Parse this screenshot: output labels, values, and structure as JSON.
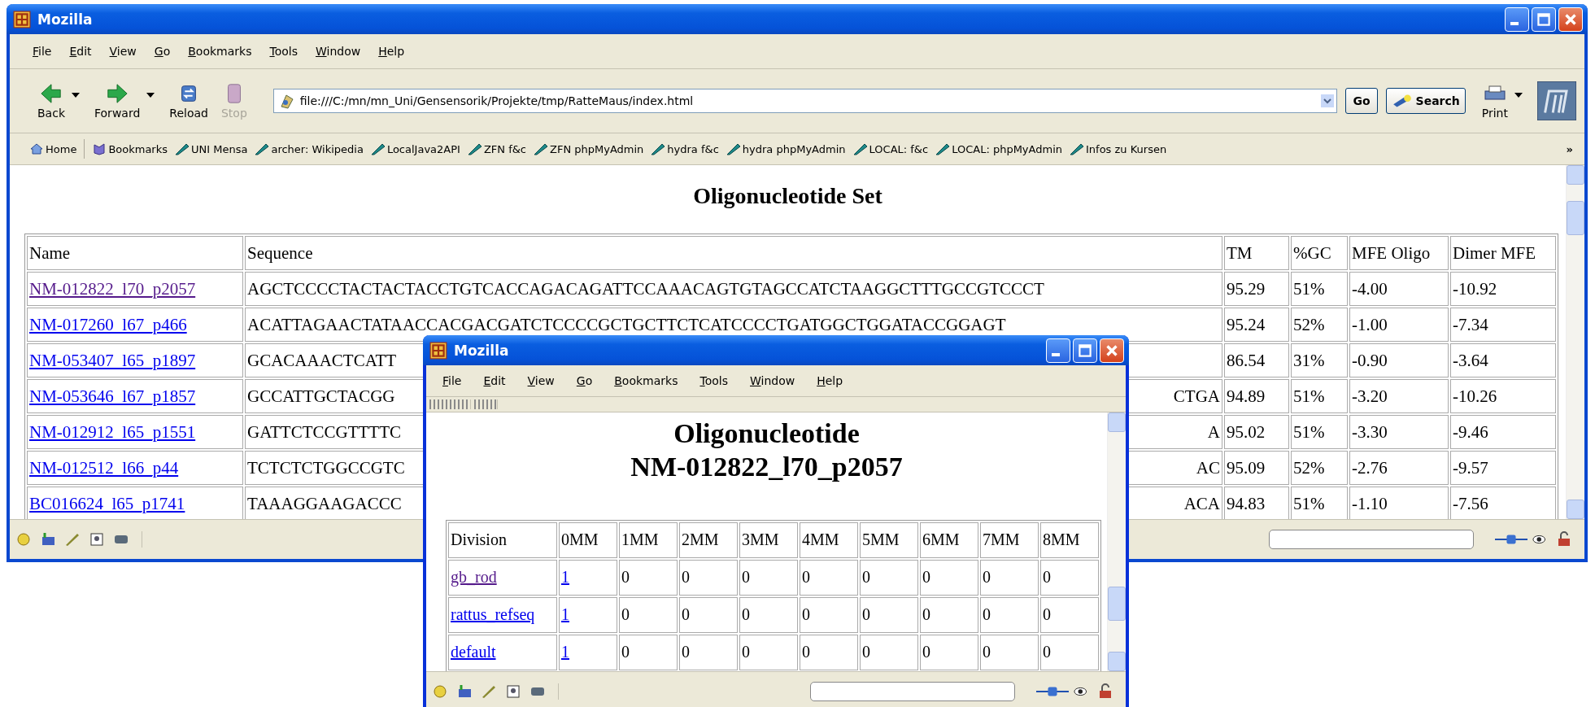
{
  "main_window": {
    "title": "Mozilla",
    "menu": [
      "File",
      "Edit",
      "View",
      "Go",
      "Bookmarks",
      "Tools",
      "Window",
      "Help"
    ],
    "nav_buttons": [
      {
        "label": "Back",
        "kind": "back",
        "disabled": false,
        "dropdown": true
      },
      {
        "label": "Forward",
        "kind": "forward",
        "disabled": false,
        "dropdown": true
      },
      {
        "label": "Reload",
        "kind": "reload",
        "disabled": false,
        "dropdown": false
      },
      {
        "label": "Stop",
        "kind": "stop",
        "disabled": true,
        "dropdown": false
      }
    ],
    "address": "file:///C:/mn/mn_Uni/Gensensorik/Projekte/tmp/RatteMaus/index.html",
    "go_button": "Go",
    "search_button": "Search",
    "print_button": "Print",
    "bookmarks": [
      {
        "label": "Home",
        "kind": "home"
      },
      {
        "label": "Bookmarks",
        "kind": "folder"
      },
      {
        "label": "UNI Mensa",
        "kind": "link"
      },
      {
        "label": "archer: Wikipedia",
        "kind": "link"
      },
      {
        "label": "LocalJava2API",
        "kind": "link"
      },
      {
        "label": "ZFN f&c",
        "kind": "link"
      },
      {
        "label": "ZFN phpMyAdmin",
        "kind": "link"
      },
      {
        "label": "hydra f&c",
        "kind": "link"
      },
      {
        "label": "hydra phpMyAdmin",
        "kind": "link"
      },
      {
        "label": "LOCAL: f&c",
        "kind": "link"
      },
      {
        "label": "LOCAL: phpMyAdmin",
        "kind": "link"
      },
      {
        "label": "Infos zu Kursen",
        "kind": "link"
      }
    ],
    "bookmarks_more": "»",
    "page": {
      "heading": "Oligonucleotide Set",
      "columns": [
        "Name",
        "Sequence",
        "TM",
        "%GC",
        "MFE Oligo",
        "Dimer MFE"
      ],
      "rows": [
        {
          "name": "NM-012822_l70_p2057",
          "visited": true,
          "sequence_start": "AGCTCCCCTACTACTACCTGTCACCAGACAGATTCCAAACAGTGTAGCCATCTAAGGCTTTGCCGTCCCT",
          "sequence_end": "",
          "tm": "95.29",
          "gc": "51%",
          "mfe_oligo": "-4.00",
          "dimer_mfe": "-10.92"
        },
        {
          "name": "NM-017260_l67_p466",
          "visited": false,
          "sequence_start": "ACATTAGAACTATAACCACGACGATCTCCCCGCTGCTTCTCATCCCCTGATGGCTGGATACCGGAGT",
          "sequence_end": "",
          "tm": "95.24",
          "gc": "52%",
          "mfe_oligo": "-1.00",
          "dimer_mfe": "-7.34"
        },
        {
          "name": "NM-053407_l65_p1897",
          "visited": false,
          "sequence_start": "GCACAAACTCATT",
          "sequence_end": "",
          "tm": "86.54",
          "gc": "31%",
          "mfe_oligo": "-0.90",
          "dimer_mfe": "-3.64"
        },
        {
          "name": "NM-053646_l67_p1857",
          "visited": false,
          "sequence_start": "GCCATTGCTACGG",
          "sequence_end": "CTGA",
          "tm": "94.89",
          "gc": "51%",
          "mfe_oligo": "-3.20",
          "dimer_mfe": "-10.26"
        },
        {
          "name": "NM-012912_l65_p1551",
          "visited": false,
          "sequence_start": "GATTCTCCGTTTTC",
          "sequence_end": "A",
          "tm": "95.02",
          "gc": "51%",
          "mfe_oligo": "-3.30",
          "dimer_mfe": "-9.46"
        },
        {
          "name": "NM-012512_l66_p44",
          "visited": false,
          "sequence_start": "TCTCTCTGGCCGTC",
          "sequence_end": "AC",
          "tm": "95.09",
          "gc": "52%",
          "mfe_oligo": "-2.76",
          "dimer_mfe": "-9.57"
        },
        {
          "name": "BC016624_l65_p1741",
          "visited": false,
          "sequence_start": "TAAAGGAAGACCC",
          "sequence_end": "ACA",
          "tm": "94.83",
          "gc": "51%",
          "mfe_oligo": "-1.10",
          "dimer_mfe": "-7.56"
        }
      ]
    }
  },
  "popup_window": {
    "title": "Mozilla",
    "menu": [
      "File",
      "Edit",
      "View",
      "Go",
      "Bookmarks",
      "Tools",
      "Window",
      "Help"
    ],
    "page": {
      "heading_line_1": "Oligonucleotide",
      "heading_line_2": "NM-012822_l70_p2057",
      "columns": [
        "Division",
        "0MM",
        "1MM",
        "2MM",
        "3MM",
        "4MM",
        "5MM",
        "6MM",
        "7MM",
        "8MM"
      ],
      "rows": [
        {
          "division": "gb_rod",
          "visited": true,
          "counts": [
            "1",
            "0",
            "0",
            "0",
            "0",
            "0",
            "0",
            "0",
            "0"
          ]
        },
        {
          "division": "rattus_refseq",
          "visited": false,
          "counts": [
            "1",
            "0",
            "0",
            "0",
            "0",
            "0",
            "0",
            "0",
            "0"
          ]
        },
        {
          "division": "default",
          "visited": false,
          "counts": [
            "1",
            "0",
            "0",
            "0",
            "0",
            "0",
            "0",
            "0",
            "0"
          ]
        }
      ]
    }
  }
}
